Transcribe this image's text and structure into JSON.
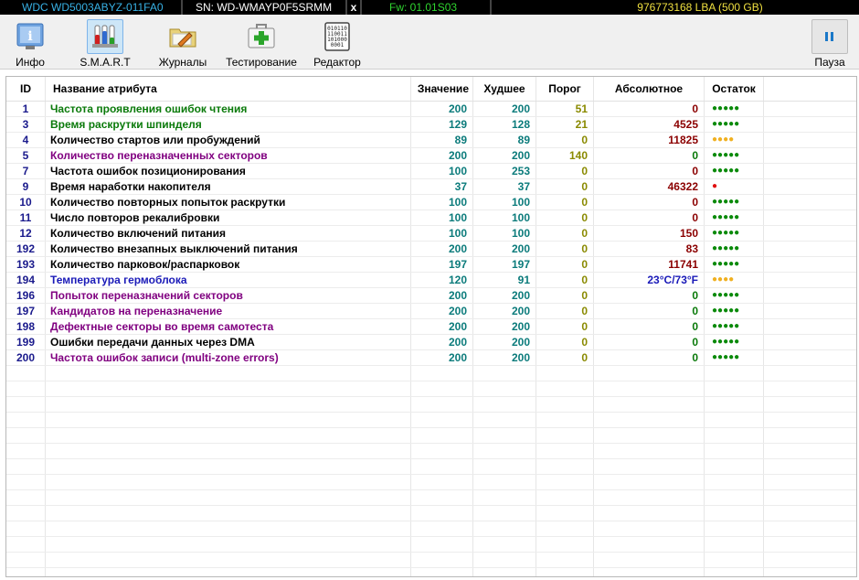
{
  "infobar": {
    "model": "WDC WD5003ABYZ-011FA0",
    "serial": "SN: WD-WMAYP0F5SRMM",
    "close": "x",
    "firmware": "Fw: 01.01S03",
    "capacity": "976773168 LBA (500 GB)"
  },
  "toolbar": {
    "info_label": "Инфо",
    "smart_label": "S.M.A.R.T",
    "logs_label": "Журналы",
    "test_label": "Тестирование",
    "editor_label": "Редактор",
    "pause_label": "Пауза",
    "active_tab": "S.M.A.R.T"
  },
  "table": {
    "headers": {
      "id": "ID",
      "name": "Название атрибута",
      "value": "Значение",
      "worst": "Худшее",
      "threshold": "Порог",
      "raw": "Абсолютное",
      "remaining": "Остаток"
    },
    "rows": [
      {
        "id": "1",
        "name": "Частота проявления ошибок чтения",
        "value": "200",
        "worst": "200",
        "threshold": "51",
        "raw": "0",
        "remaining": "●●●●●",
        "name_color": "t-green",
        "raw_color": "v-maroon",
        "dot_color": "d-green"
      },
      {
        "id": "3",
        "name": "Время раскрутки шпинделя",
        "value": "129",
        "worst": "128",
        "threshold": "21",
        "raw": "4525",
        "remaining": "●●●●●",
        "name_color": "t-green",
        "raw_color": "v-maroon",
        "dot_color": "d-green"
      },
      {
        "id": "4",
        "name": "Количество стартов или пробуждений",
        "value": "89",
        "worst": "89",
        "threshold": "0",
        "raw": "11825",
        "remaining": "●●●●",
        "name_color": "t-black",
        "raw_color": "v-maroon",
        "dot_color": "d-orange"
      },
      {
        "id": "5",
        "name": "Количество переназначенных секторов",
        "value": "200",
        "worst": "200",
        "threshold": "140",
        "raw": "0",
        "remaining": "●●●●●",
        "name_color": "t-purple",
        "raw_color": "v-green",
        "dot_color": "d-green"
      },
      {
        "id": "7",
        "name": "Частота ошибок позиционирования",
        "value": "100",
        "worst": "253",
        "threshold": "0",
        "raw": "0",
        "remaining": "●●●●●",
        "name_color": "t-black",
        "raw_color": "v-maroon",
        "dot_color": "d-green"
      },
      {
        "id": "9",
        "name": "Время наработки накопителя",
        "value": "37",
        "worst": "37",
        "threshold": "0",
        "raw": "46322",
        "remaining": "●",
        "name_color": "t-black",
        "raw_color": "v-maroon",
        "dot_color": "d-red"
      },
      {
        "id": "10",
        "name": "Количество повторных попыток раскрутки",
        "value": "100",
        "worst": "100",
        "threshold": "0",
        "raw": "0",
        "remaining": "●●●●●",
        "name_color": "t-black",
        "raw_color": "v-maroon",
        "dot_color": "d-green"
      },
      {
        "id": "11",
        "name": "Число повторов рекалибровки",
        "value": "100",
        "worst": "100",
        "threshold": "0",
        "raw": "0",
        "remaining": "●●●●●",
        "name_color": "t-black",
        "raw_color": "v-maroon",
        "dot_color": "d-green"
      },
      {
        "id": "12",
        "name": "Количество включений питания",
        "value": "100",
        "worst": "100",
        "threshold": "0",
        "raw": "150",
        "remaining": "●●●●●",
        "name_color": "t-black",
        "raw_color": "v-maroon",
        "dot_color": "d-green"
      },
      {
        "id": "192",
        "name": "Количество внезапных выключений питания",
        "value": "200",
        "worst": "200",
        "threshold": "0",
        "raw": "83",
        "remaining": "●●●●●",
        "name_color": "t-black",
        "raw_color": "v-maroon",
        "dot_color": "d-green"
      },
      {
        "id": "193",
        "name": "Количество парковок/распарковок",
        "value": "197",
        "worst": "197",
        "threshold": "0",
        "raw": "11741",
        "remaining": "●●●●●",
        "name_color": "t-black",
        "raw_color": "v-maroon",
        "dot_color": "d-green"
      },
      {
        "id": "194",
        "name": "Температура гермоблока",
        "value": "120",
        "worst": "91",
        "threshold": "0",
        "raw": "23°C/73°F",
        "remaining": "●●●●",
        "name_color": "t-blue",
        "raw_color": "v-blue",
        "dot_color": "d-orange"
      },
      {
        "id": "196",
        "name": "Попыток переназначений секторов",
        "value": "200",
        "worst": "200",
        "threshold": "0",
        "raw": "0",
        "remaining": "●●●●●",
        "name_color": "t-purple",
        "raw_color": "v-green",
        "dot_color": "d-green"
      },
      {
        "id": "197",
        "name": "Кандидатов на переназначение",
        "value": "200",
        "worst": "200",
        "threshold": "0",
        "raw": "0",
        "remaining": "●●●●●",
        "name_color": "t-purple",
        "raw_color": "v-green",
        "dot_color": "d-green"
      },
      {
        "id": "198",
        "name": "Дефектные секторы во время самотеста",
        "value": "200",
        "worst": "200",
        "threshold": "0",
        "raw": "0",
        "remaining": "●●●●●",
        "name_color": "t-purple",
        "raw_color": "v-green",
        "dot_color": "d-green"
      },
      {
        "id": "199",
        "name": "Ошибки передачи данных через DMA",
        "value": "200",
        "worst": "200",
        "threshold": "0",
        "raw": "0",
        "remaining": "●●●●●",
        "name_color": "t-black",
        "raw_color": "v-green",
        "dot_color": "d-green"
      },
      {
        "id": "200",
        "name": "Частота ошибок записи (multi-zone errors)",
        "value": "200",
        "worst": "200",
        "threshold": "0",
        "raw": "0",
        "remaining": "●●●●●",
        "name_color": "t-purple",
        "raw_color": "v-green",
        "dot_color": "d-green"
      }
    ]
  },
  "colors": {
    "model_text": "#38b2e6",
    "firmware_text": "#2fd52f",
    "capacity_text": "#f0e040",
    "value_teal": "#0b7b7b",
    "threshold_olive": "#8a8a00",
    "raw_maroon": "#8b0000"
  },
  "icons": {
    "info": "info-icon",
    "smart": "test-tubes-icon",
    "logs": "folder-pencil-icon",
    "test": "medkit-icon",
    "editor": "binary-editor-icon",
    "pause": "pause-icon"
  }
}
